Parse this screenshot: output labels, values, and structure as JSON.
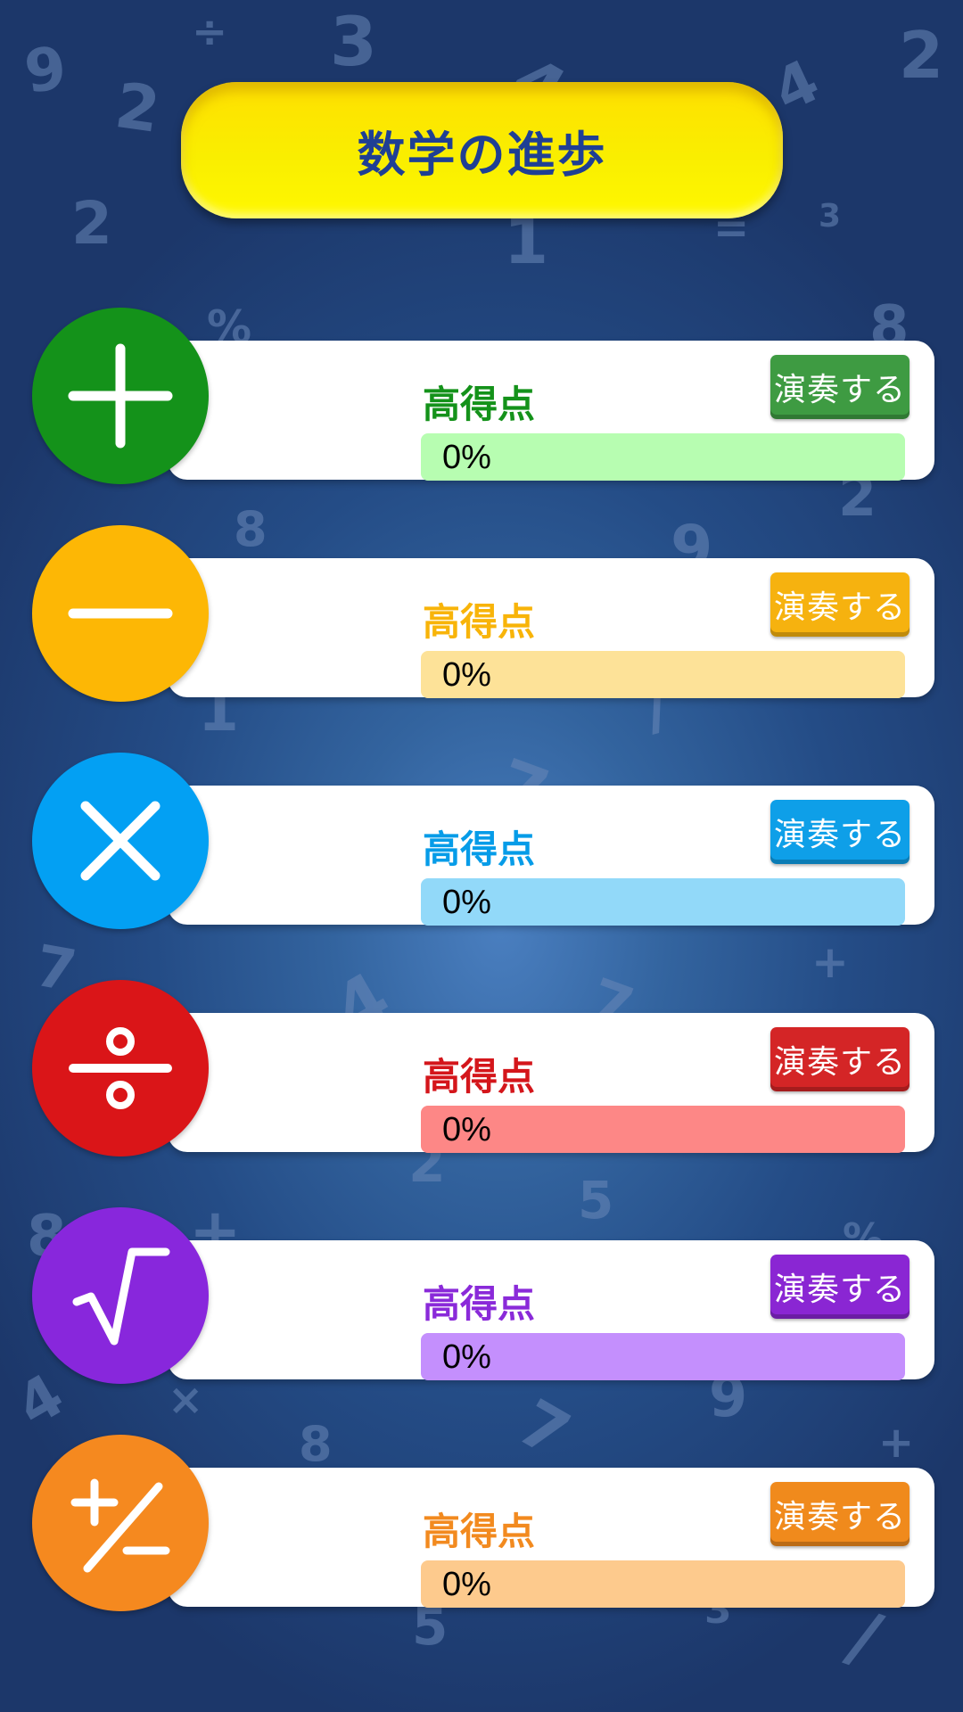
{
  "title": "数学の進歩",
  "operations": [
    {
      "icon": "plus-icon",
      "label": "高得点",
      "progress_text": "0%",
      "progress": 0,
      "button": "演奏する",
      "color": "#14921a",
      "text_color": "#14921a",
      "track_color": "#b7fdb1",
      "button_color": "#3e9b42"
    },
    {
      "icon": "minus-icon",
      "label": "高得点",
      "progress_text": "0%",
      "progress": 0,
      "button": "演奏する",
      "color": "#fdb705",
      "text_color": "#f8b409",
      "track_color": "#fde298",
      "button_color": "#f6b20f"
    },
    {
      "icon": "multiply-icon",
      "label": "高得点",
      "progress_text": "0%",
      "progress": 0,
      "button": "演奏する",
      "color": "#03a0f3",
      "text_color": "#069ce8",
      "track_color": "#92d9f9",
      "button_color": "#0e9fe8"
    },
    {
      "icon": "divide-icon",
      "label": "高得点",
      "progress_text": "0%",
      "progress": 0,
      "button": "演奏する",
      "color": "#da1518",
      "text_color": "#d4161b",
      "track_color": "#fd8786",
      "button_color": "#d42526"
    },
    {
      "icon": "square-root-icon",
      "label": "高得点",
      "progress_text": "0%",
      "progress": 0,
      "button": "演奏する",
      "color": "#8827dc",
      "text_color": "#8a2ad9",
      "track_color": "#c48ffd",
      "button_color": "#8a26d3"
    },
    {
      "icon": "plus-minus-icon",
      "label": "高得点",
      "progress_text": "0%",
      "progress": 0,
      "button": "演奏する",
      "color": "#f5891f",
      "text_color": "#f28a1f",
      "track_color": "#fdca8d",
      "button_color": "#f08a1c"
    }
  ]
}
